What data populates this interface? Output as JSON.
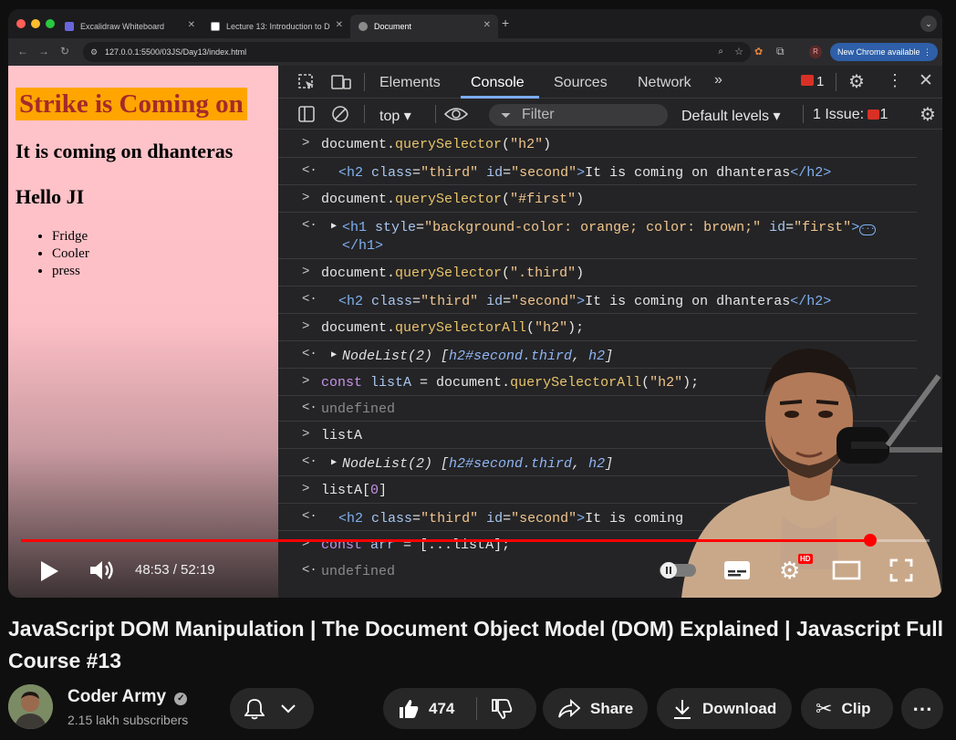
{
  "browser": {
    "tabs": [
      {
        "title": "Excalidraw Whiteboard",
        "active": false
      },
      {
        "title": "Lecture 13: Introduction to D",
        "active": false
      },
      {
        "title": "Document",
        "active": true
      }
    ],
    "url": "127.0.0.1:5500/03JS/Day13/index.html",
    "profile_initial": "R",
    "new_chrome": "New Chrome available"
  },
  "webpage": {
    "h1": "Strike is Coming on",
    "h2_first": "It is coming on dhanteras",
    "h2_second": "Hello JI",
    "list": [
      "Fridge",
      "Cooler",
      "press"
    ]
  },
  "devtools": {
    "tabs": [
      "Elements",
      "Console",
      "Sources",
      "Network"
    ],
    "active_tab": "Console",
    "error_count": "1",
    "context": "top",
    "filter_placeholder": "Filter",
    "levels": "Default levels",
    "issues_label": "1 Issue:",
    "issues_count": "1"
  },
  "player": {
    "time": "48:53 / 52:19",
    "progress": 0.9345,
    "hd_badge": "HD"
  },
  "video": {
    "title": "JavaScript DOM Manipulation | The Document Object Model (DOM) Explained | Javascript Full Course #13",
    "channel": "Coder Army",
    "subscribers": "2.15 lakh subscribers",
    "likes": "474",
    "share": "Share",
    "download": "Download",
    "clip": "Clip"
  },
  "colors": {
    "accent_red": "#ff0000",
    "page_bg": "#ffc0cb",
    "h1_bg": "#ffa500",
    "h1_fg": "#a52a2a",
    "devtools_bg": "#242426",
    "devtools_tab_underline": "#7cacf8"
  }
}
